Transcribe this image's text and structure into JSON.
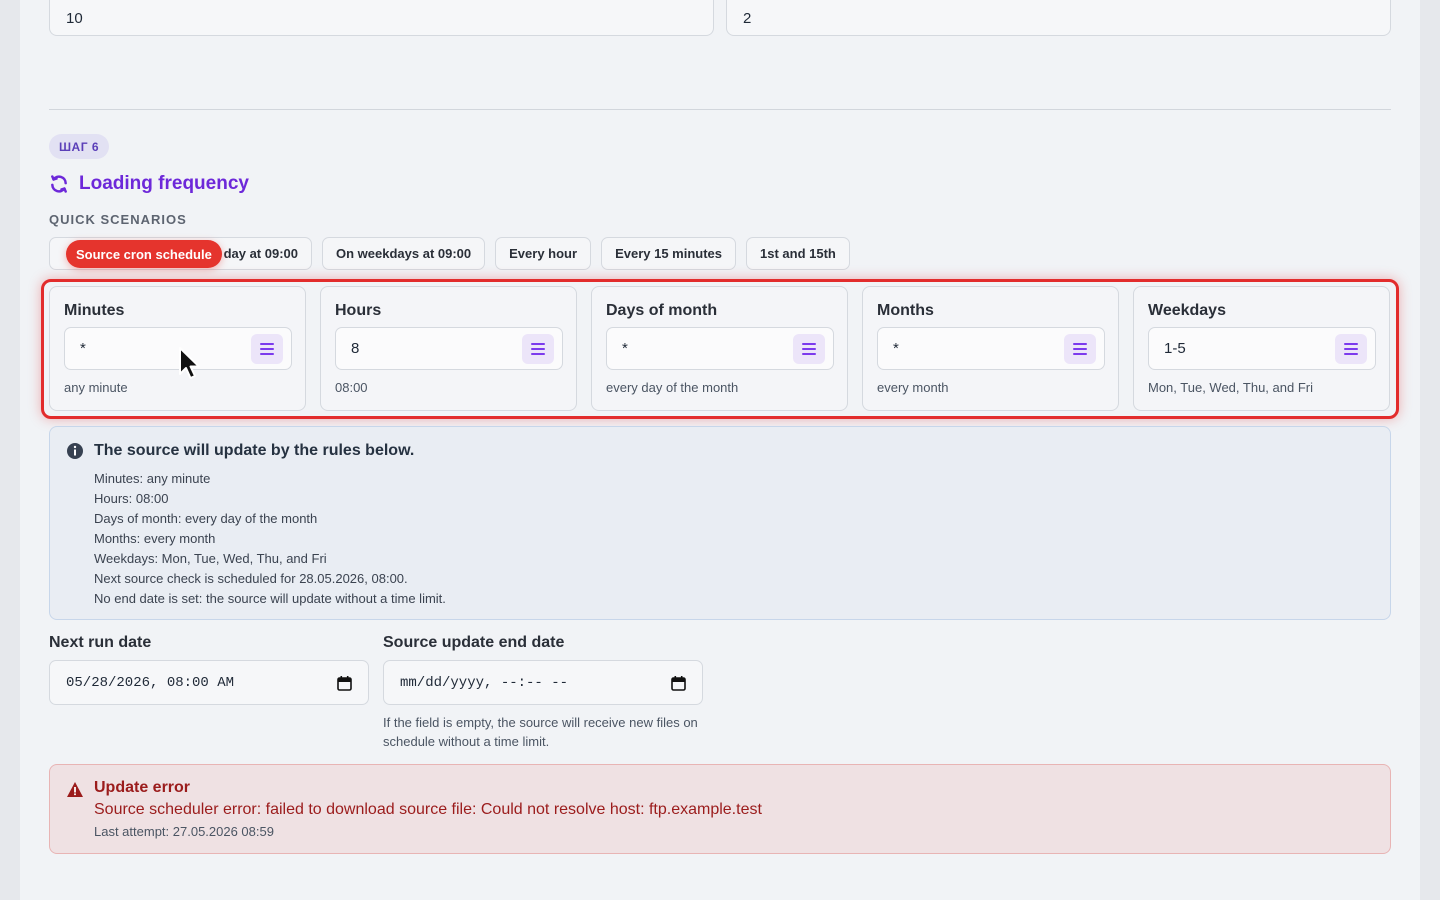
{
  "top_fields": {
    "left_value": "10",
    "right_value": "2"
  },
  "step": {
    "badge": "ШАГ 6",
    "title": "Loading frequency",
    "quick_label": "QUICK SCENARIOS",
    "chips": [
      "day at 09:00",
      "On weekdays at 09:00",
      "Every hour",
      "Every 15 minutes",
      "1st and 15th"
    ],
    "tooltip": "Source cron schedule"
  },
  "cron": [
    {
      "label": "Minutes",
      "value": "*",
      "desc": "any minute"
    },
    {
      "label": "Hours",
      "value": "8",
      "desc": "08:00"
    },
    {
      "label": "Days of month",
      "value": "*",
      "desc": "every day of the month"
    },
    {
      "label": "Months",
      "value": "*",
      "desc": "every month"
    },
    {
      "label": "Weekdays",
      "value": "1-5",
      "desc": "Mon, Tue, Wed, Thu, and Fri"
    }
  ],
  "info": {
    "title": "The source will update by the rules below.",
    "lines": [
      "Minutes: any minute",
      "Hours: 08:00",
      "Days of month: every day of the month",
      "Months: every month",
      "Weekdays: Mon, Tue, Wed, Thu, and Fri",
      "Next source check is scheduled for 28.05.2026, 08:00.",
      "No end date is set: the source will update without a time limit."
    ]
  },
  "dates": {
    "next_run_label": "Next run date",
    "next_run_value": "05/28/2026, 08:00 AM",
    "end_label": "Source update end date",
    "end_value": "mm/dd/yyyy, --:-- --",
    "hint": "If the field is empty, the source will receive new files on schedule without a time limit."
  },
  "error": {
    "title": "Update error",
    "message": "Source scheduler error: failed to download source file: Could not resolve host: ftp.example.test",
    "last_attempt": "Last attempt: 27.05.2026 08:59"
  },
  "colors": {
    "accent": "#6d28d9",
    "highlight": "#e22c2c",
    "error": "#9b1c1c"
  }
}
